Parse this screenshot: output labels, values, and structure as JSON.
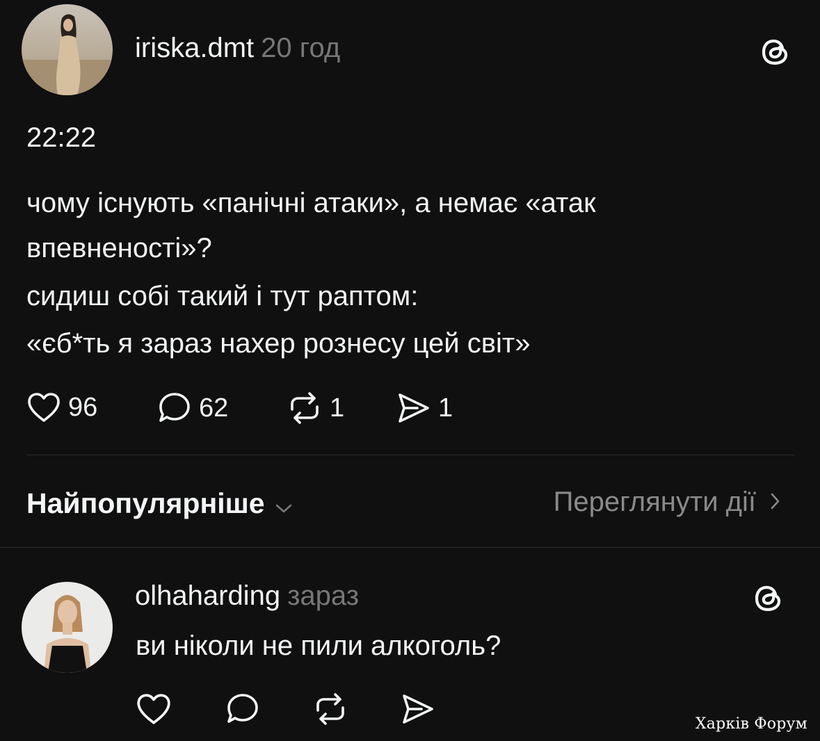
{
  "post": {
    "username": "iriska.dmt",
    "time_ago": "20 год",
    "lines": [
      "22:22",
      "чому існують «панічні атаки», а немає «атак",
      "впевненості»?",
      "сидиш собі такий і тут раптом:",
      "«єб*ть я зараз нахер рознесу цей світ»"
    ],
    "likes": "96",
    "comments": "62",
    "reposts": "1",
    "shares": "1"
  },
  "sort": {
    "label": "Найпопулярніше",
    "view_activity": "Переглянути дії"
  },
  "reply": {
    "username": "olhaharding",
    "time_ago": "зараз",
    "text": "ви ніколи не пили алкоголь?"
  },
  "watermark": "Харків Форум",
  "icons": {
    "threads": "threads-logo-icon",
    "like": "heart-icon",
    "comment": "comment-bubble-icon",
    "repost": "repost-icon",
    "share": "send-icon",
    "sort_chevron": "chevron-down-icon",
    "activity_chevron": "chevron-right-icon"
  },
  "colors": {
    "background": "#101010",
    "text_primary": "#f3f5f7",
    "text_secondary": "#777777",
    "divider": "#2a2a2a"
  }
}
